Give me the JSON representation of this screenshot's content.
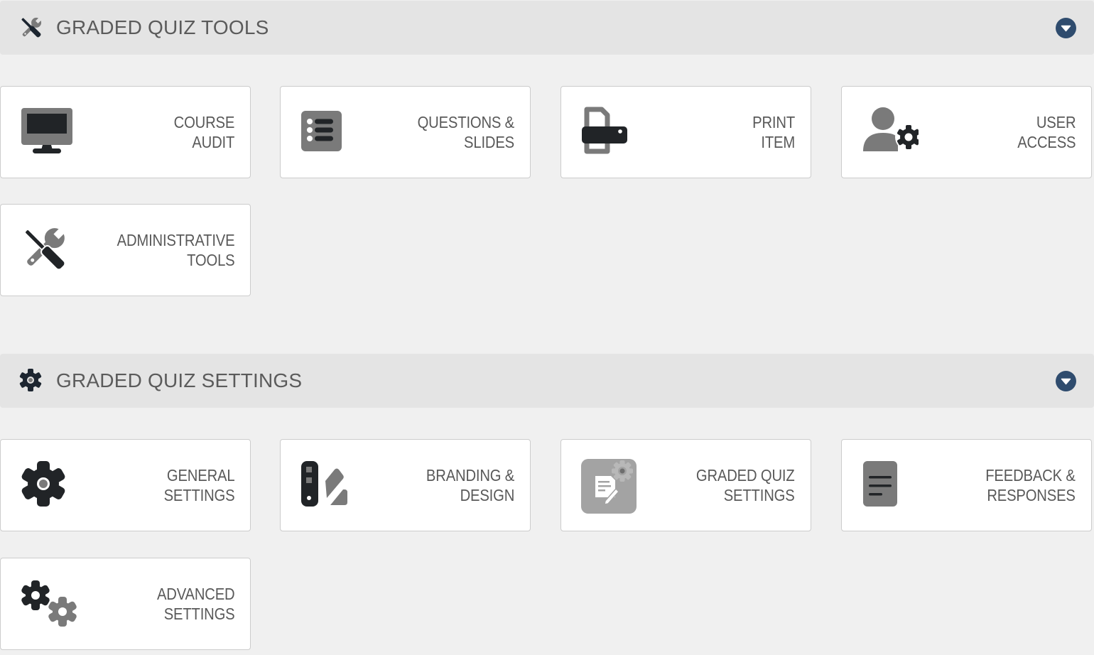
{
  "sections": [
    {
      "title": "GRADED QUIZ TOOLS",
      "icon": "tools-icon",
      "toggle_icon": "chevron-down-circle-icon",
      "cards": [
        {
          "line1": "COURSE",
          "line2": "AUDIT",
          "icon": "monitor-icon"
        },
        {
          "line1": "QUESTIONS &",
          "line2": "SLIDES",
          "icon": "list-icon"
        },
        {
          "line1": "PRINT",
          "line2": "ITEM",
          "icon": "printer-icon"
        },
        {
          "line1": "USER",
          "line2": "ACCESS",
          "icon": "user-gear-icon"
        },
        {
          "line1": "ADMINISTRATIVE",
          "line2": "TOOLS",
          "icon": "tools-icon"
        }
      ]
    },
    {
      "title": "GRADED QUIZ SETTINGS",
      "icon": "gear-icon",
      "toggle_icon": "chevron-down-circle-icon",
      "cards": [
        {
          "line1": "GENERAL",
          "line2": "SETTINGS",
          "icon": "gear-icon"
        },
        {
          "line1": "BRANDING &",
          "line2": "DESIGN",
          "icon": "swatchbook-icon"
        },
        {
          "line1": "GRADED QUIZ",
          "line2": "SETTINGS",
          "icon": "quiz-settings-icon"
        },
        {
          "line1": "FEEDBACK &",
          "line2": "RESPONSES",
          "icon": "feedback-document-icon"
        },
        {
          "line1": "ADVANCED",
          "line2": "SETTINGS",
          "icon": "gears-icon"
        }
      ]
    }
  ],
  "colors": {
    "dark_icon": "#212427",
    "gray_icon": "#7a7a7a",
    "toggle": "#2f4c6e",
    "header_bg": "#e4e4e4",
    "page_bg": "#f0f0f0",
    "label": "#595959"
  }
}
